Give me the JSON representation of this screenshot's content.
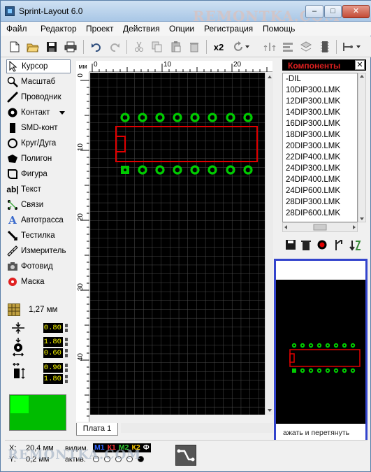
{
  "window": {
    "title": "Sprint-Layout 6.0",
    "watermark": "REMONTKA.COM",
    "controls": {
      "minimize": "–",
      "maximize": "□",
      "close": "✕"
    }
  },
  "menu": [
    "Файл",
    "Редактор",
    "Проект",
    "Действия",
    "Опции",
    "Регистрация",
    "Помощь"
  ],
  "toolbar": {
    "icons": [
      "new-file-icon",
      "open-folder-icon",
      "save-icon",
      "print-icon",
      "undo-icon",
      "redo-icon",
      "cut-icon",
      "copy-icon",
      "paste-icon",
      "delete-icon",
      "duplicate-icon",
      "rotate-icon",
      "mirror-icon",
      "align-icon",
      "group-icon",
      "component-icon",
      "connect-icon"
    ],
    "x2_label": "x2"
  },
  "tools": [
    {
      "label": "Курсор",
      "icon": "cursor-icon",
      "active": true
    },
    {
      "label": "Масштаб",
      "icon": "zoom-icon"
    },
    {
      "label": "Проводник",
      "icon": "track-icon"
    },
    {
      "label": "Контакт",
      "icon": "pad-icon"
    },
    {
      "label": "SMD-конт",
      "icon": "smd-pad-icon"
    },
    {
      "label": "Круг/Дуга",
      "icon": "circle-icon"
    },
    {
      "label": "Полигон",
      "icon": "polygon-icon"
    },
    {
      "label": "Фигура",
      "icon": "shape-icon"
    },
    {
      "label": "Текст",
      "icon": "text-icon"
    },
    {
      "label": "Связи",
      "icon": "connections-icon"
    },
    {
      "label": "Автотрасса",
      "icon": "autoroute-icon"
    },
    {
      "label": "Тестилка",
      "icon": "tester-icon"
    },
    {
      "label": "Измеритель",
      "icon": "measure-icon"
    },
    {
      "label": "Фотовид",
      "icon": "photo-icon"
    },
    {
      "label": "Маска",
      "icon": "mask-icon"
    }
  ],
  "grid": {
    "value": "1,27 мм"
  },
  "params": {
    "track_width": "0.80",
    "pad_outer": "1.80",
    "pad_inner": "0.60",
    "smd_width": "0.90",
    "smd_height": "1.80"
  },
  "ruler": {
    "unit": "мм",
    "top_ticks": [
      "0",
      "10",
      "20"
    ],
    "left_ticks": [
      "0",
      "10",
      "20",
      "30",
      "40"
    ]
  },
  "board": {
    "tab_label": "Плата 1"
  },
  "components": {
    "title": "Компоненты",
    "close": "✕",
    "items": [
      "-DIL",
      "10DIP300.LMK",
      "12DIP300.LMK",
      "14DIP300.LMK",
      "16DIP300.LMK",
      "18DIP300.LMK",
      "20DIP300.LMK",
      "22DIP400.LMK",
      "24DIP300.LMK",
      "24DIP400.LMK",
      "24DIP600.LMK",
      "28DIP300.LMK",
      "28DIP600.LMK"
    ]
  },
  "preview": {
    "hint": "ажать и перетянуть"
  },
  "status": {
    "x_label": "X:",
    "x_value": "20,4 мм",
    "y_label": "Y:",
    "y_value": "0,2 мм",
    "visible_label": "видим.",
    "active_label": "актив.",
    "layers": [
      {
        "name": "М1",
        "color": "#3366ff"
      },
      {
        "name": "К1",
        "color": "#ff3333"
      },
      {
        "name": "М2",
        "color": "#33cc33"
      },
      {
        "name": "К2",
        "color": "#ffcc00"
      },
      {
        "name": "Ф",
        "color": "#ffffff"
      }
    ]
  },
  "colors": {
    "pad": "#00cc00",
    "outline": "#e00000",
    "board": "#000000",
    "grid": "#4a4a4a",
    "highlight_frame": "#3344cc"
  }
}
